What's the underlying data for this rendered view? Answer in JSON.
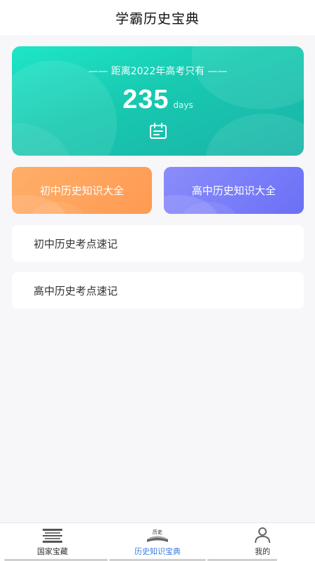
{
  "header": {
    "title": "学霸历史宝典"
  },
  "countdown": {
    "title": "—— 距离2022年高考只有 ——",
    "days": "235",
    "unit": "days",
    "icon": "calendar-icon"
  },
  "cards": [
    {
      "label": "初中历史知识大全",
      "color": "#ffa45c"
    },
    {
      "label": "高中历史知识大全",
      "color": "#7a7ef8"
    }
  ],
  "list": [
    {
      "label": "初中历史考点速记"
    },
    {
      "label": "高中历史考点速记"
    }
  ],
  "tabbar": {
    "items": [
      {
        "label": "国家宝藏",
        "icon": "treasure-icon"
      },
      {
        "label": "历史知识宝典",
        "icon": "history-book-icon",
        "icon_text": "历史"
      },
      {
        "label": "我的",
        "icon": "user-icon"
      }
    ],
    "active_color": "#3a7be0"
  }
}
